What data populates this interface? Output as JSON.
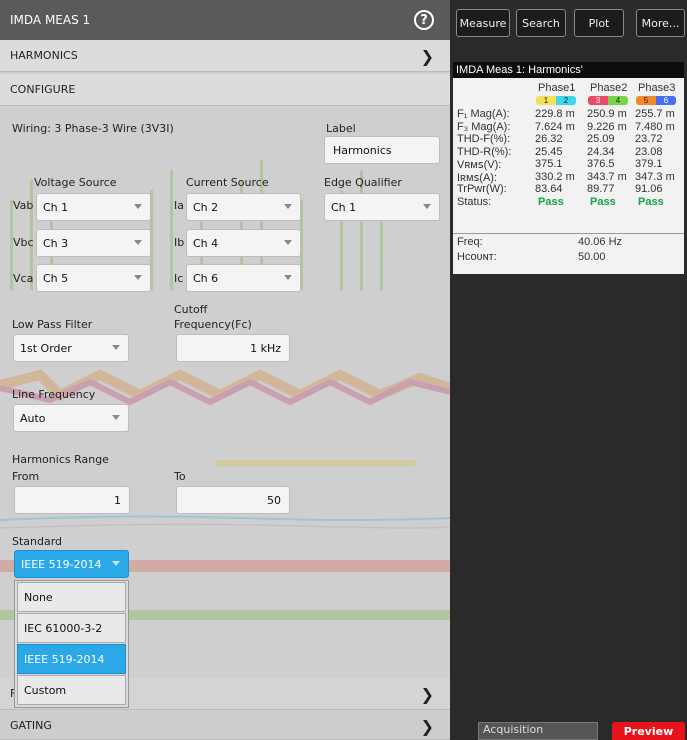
{
  "panel": {
    "title": "IMDA MEAS 1",
    "sections": {
      "harmonics": "HARMONICS",
      "configure": "CONFIGURE",
      "gating": "GATING"
    },
    "wiring": "Wiring: 3 Phase-3 Wire (3V3I)",
    "label": {
      "caption": "Label",
      "value": "Harmonics"
    },
    "voltage_source": {
      "caption": "Voltage Source",
      "rows": [
        {
          "name": "Vab",
          "value": "Ch 1"
        },
        {
          "name": "Vbc",
          "value": "Ch 3"
        },
        {
          "name": "Vca",
          "value": "Ch 5"
        }
      ]
    },
    "current_source": {
      "caption": "Current Source",
      "rows": [
        {
          "name": "Ia",
          "value": "Ch 2"
        },
        {
          "name": "Ib",
          "value": "Ch 4"
        },
        {
          "name": "Ic",
          "value": "Ch 6"
        }
      ]
    },
    "edge_qualifier": {
      "caption": "Edge Qualifier",
      "value": "Ch 1"
    },
    "low_pass_filter": {
      "caption": "Low Pass Filter",
      "value": "1st Order"
    },
    "cutoff": {
      "caption_line1": "Cutoff",
      "caption_line2": "Frequency(Fc)",
      "value": "1 kHz"
    },
    "line_frequency": {
      "caption": "Line Frequency",
      "value": "Auto"
    },
    "harmonics_range": {
      "caption": "Harmonics Range",
      "from_label": "From",
      "from_value": "1",
      "to_label": "To",
      "to_value": "50"
    },
    "standard": {
      "caption": "Standard",
      "value": "IEEE 519-2014",
      "options": [
        "None",
        "IEC 61000-3-2",
        "IEEE 519-2014",
        "Custom"
      ],
      "selected_index": 2
    },
    "hidden_row_letter": "F"
  },
  "toolbar": {
    "measure": "Measure",
    "search": "Search",
    "plot": "Plot",
    "more": "More..."
  },
  "results": {
    "title": "IMDA Meas 1: Harmonics'",
    "phases": [
      "Phase1",
      "Phase2",
      "Phase3"
    ],
    "phase_badges": [
      {
        "a": "1",
        "b": "2",
        "color_a": "#f2e25a",
        "color_b": "#3fd6e6"
      },
      {
        "a": "3",
        "b": "4",
        "color_a": "#e84a6a",
        "color_b": "#7ad44a"
      },
      {
        "a": "5",
        "b": "6",
        "color_a": "#f08a2c",
        "color_b": "#4a6ef0"
      }
    ],
    "rows": [
      {
        "label": "F₁ Mag(A):",
        "values": [
          "229.8 m",
          "250.9 m",
          "255.7 m"
        ]
      },
      {
        "label": "F₃ Mag(A):",
        "values": [
          "7.624 m",
          "9.226 m",
          "7.480 m"
        ]
      },
      {
        "label": "THD-F(%):",
        "values": [
          "26.32",
          "25.09",
          "23.72"
        ]
      },
      {
        "label": "THD-R(%):",
        "values": [
          "25.45",
          "24.34",
          "23.08"
        ]
      },
      {
        "label": "Vʀᴍꜱ(V):",
        "values": [
          "375.1",
          "376.5",
          "379.1"
        ]
      },
      {
        "label": "Iʀᴍꜱ(A):",
        "values": [
          "330.2 m",
          "343.7 m",
          "347.3 m"
        ]
      },
      {
        "label": "TrPwr(W):",
        "values": [
          "83.64",
          "89.77",
          "91.06"
        ]
      }
    ],
    "status_label": "Status:",
    "status_values": [
      "Pass",
      "Pass",
      "Pass"
    ],
    "freq_label": "Freq:",
    "freq_value": "40.06 Hz",
    "hcount_label": "Hᴄᴏᴜɴᴛ:",
    "hcount_value": "50.00"
  },
  "footer": {
    "acquisition": "Acquisition",
    "preview": "Preview"
  },
  "colors": {
    "accent": "#2aa8e8",
    "pass": "#16a24a",
    "preview": "#e8141b"
  }
}
